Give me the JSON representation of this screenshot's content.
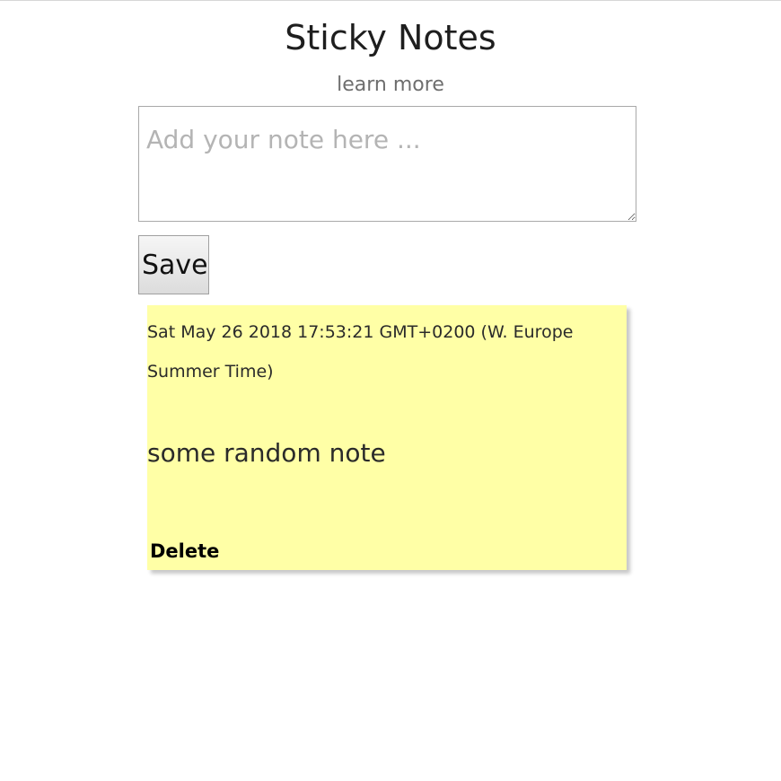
{
  "header": {
    "title": "Sticky Notes",
    "learn_more_label": "learn more"
  },
  "composer": {
    "placeholder": "Add your note here ...",
    "value": "",
    "save_label": "Save"
  },
  "notes": [
    {
      "timestamp": "Sat May 26 2018 17:53:21 GMT+0200 (W. Europe Summer Time)",
      "text": "some random note",
      "delete_label": "Delete"
    }
  ],
  "colors": {
    "note_background": "#ffffa6",
    "muted_text": "#6e6e6e",
    "placeholder_text": "#b4b4b4"
  }
}
